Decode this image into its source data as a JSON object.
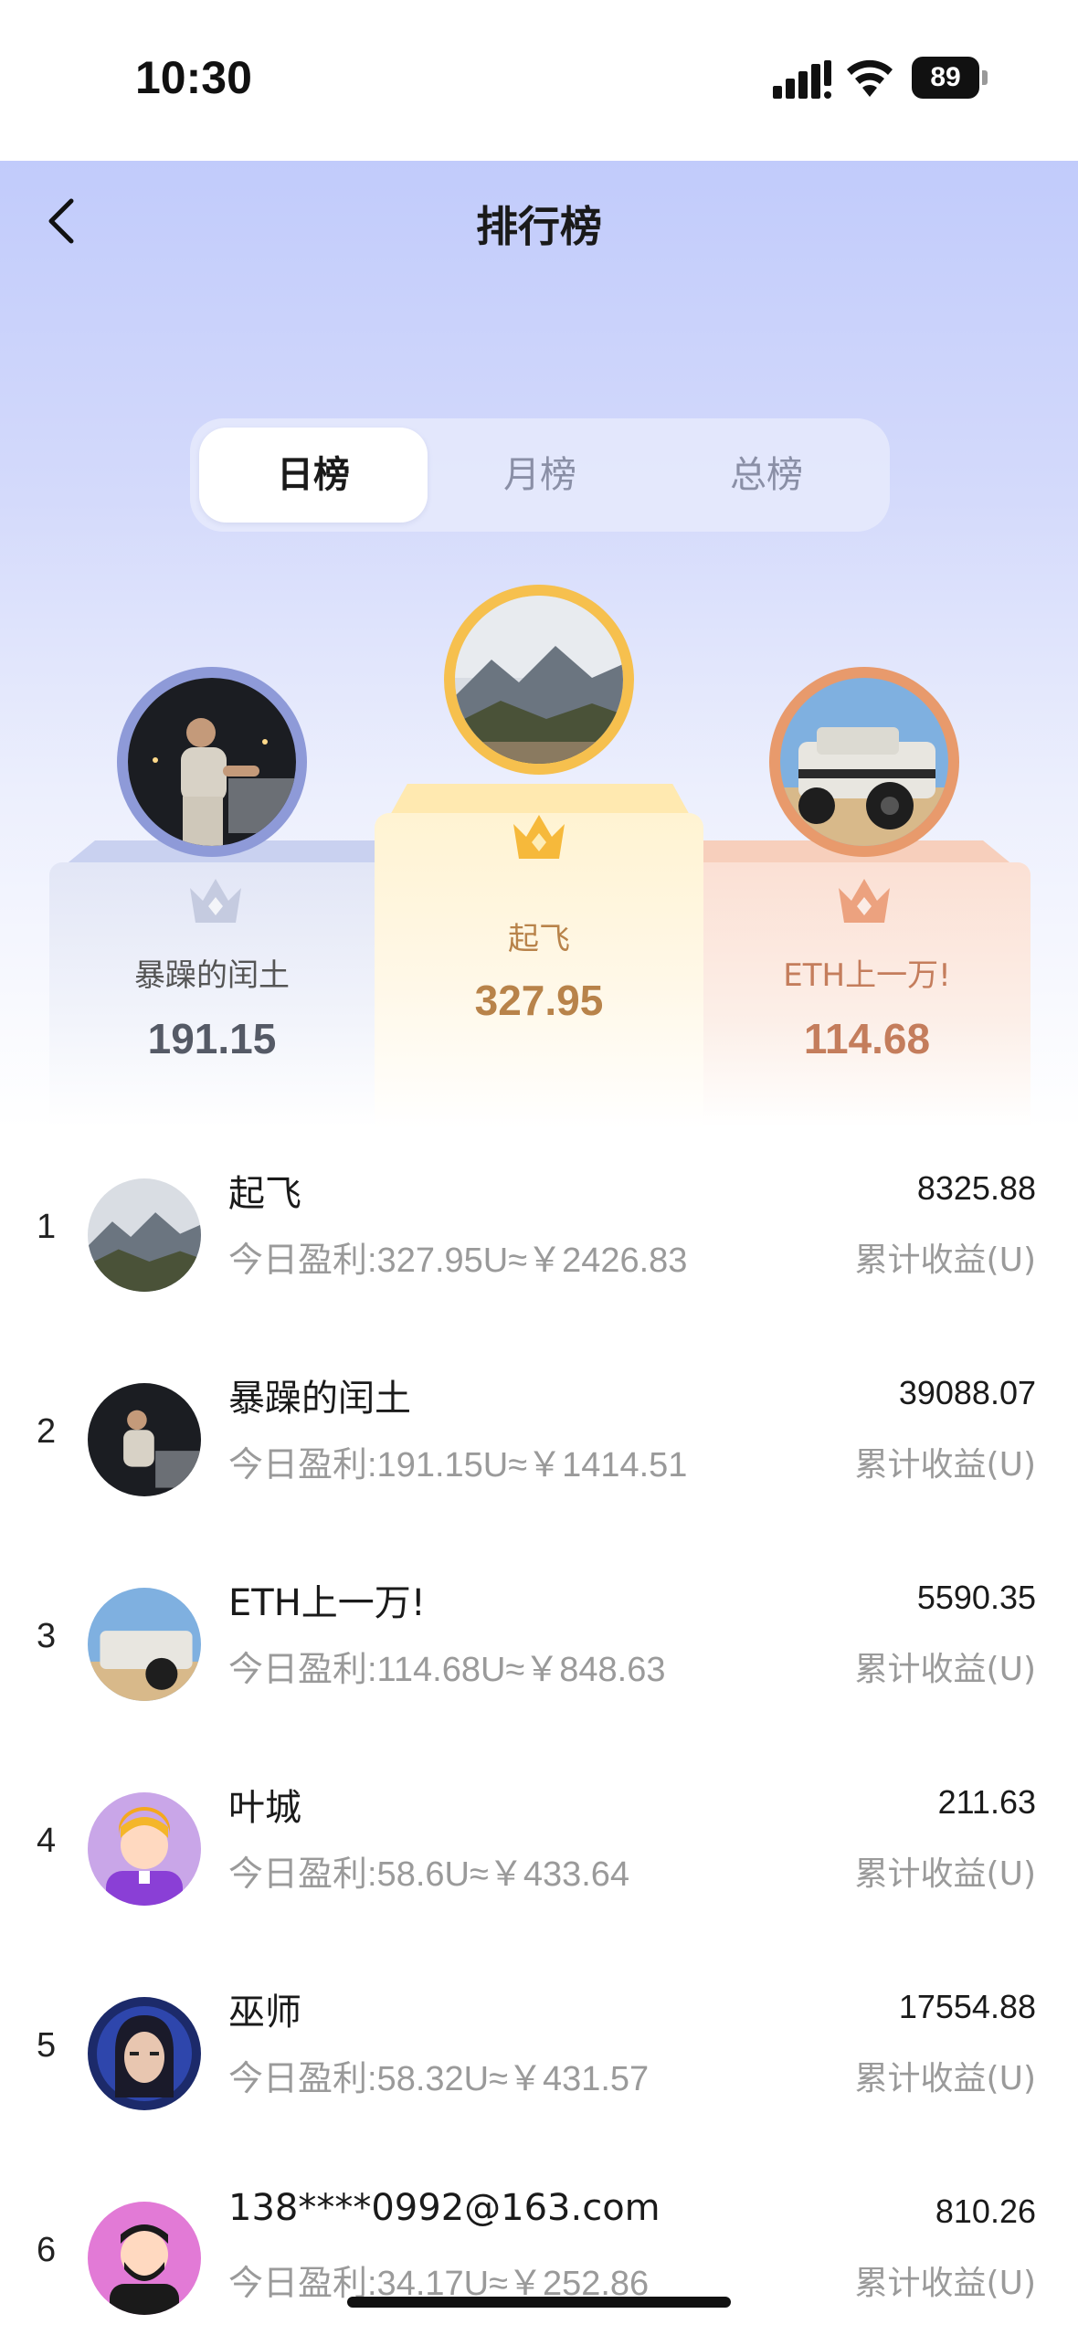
{
  "status_bar": {
    "time": "10:30",
    "battery": "89"
  },
  "header": {
    "title": "排行榜"
  },
  "tabs": [
    {
      "label": "日榜",
      "active": true
    },
    {
      "label": "月榜",
      "active": false
    },
    {
      "label": "总榜",
      "active": false
    }
  ],
  "podium": {
    "first": {
      "name": "起飞",
      "score": "327.95"
    },
    "second": {
      "name": "暴躁的闰土",
      "score": "191.15"
    },
    "third": {
      "name": "ETH上一万!",
      "score": "114.68"
    }
  },
  "list": [
    {
      "rank": "1",
      "name": "起飞",
      "today": "今日盈利:327.95U≈￥2426.83",
      "total": "8325.88",
      "total_label": "累计收益(U)"
    },
    {
      "rank": "2",
      "name": "暴躁的闰土",
      "today": "今日盈利:191.15U≈￥1414.51",
      "total": "39088.07",
      "total_label": "累计收益(U)"
    },
    {
      "rank": "3",
      "name": "ETH上一万!",
      "today": "今日盈利:114.68U≈￥848.63",
      "total": "5590.35",
      "total_label": "累计收益(U)"
    },
    {
      "rank": "4",
      "name": "叶城",
      "today": "今日盈利:58.6U≈￥433.64",
      "total": "211.63",
      "total_label": "累计收益(U)"
    },
    {
      "rank": "5",
      "name": "巫师",
      "today": "今日盈利:58.32U≈￥431.57",
      "total": "17554.88",
      "total_label": "累计收益(U)"
    },
    {
      "rank": "6",
      "name": "138****0992@163.com",
      "today": "今日盈利:34.17U≈￥252.86",
      "total": "810.26",
      "total_label": "累计收益(U)"
    }
  ],
  "colors": {
    "gold": "#f6c04e",
    "silver": "#8e9ad8",
    "bronze": "#e89a6c",
    "gold_text": "#b8834a",
    "bronze_text": "#c47d5c"
  }
}
